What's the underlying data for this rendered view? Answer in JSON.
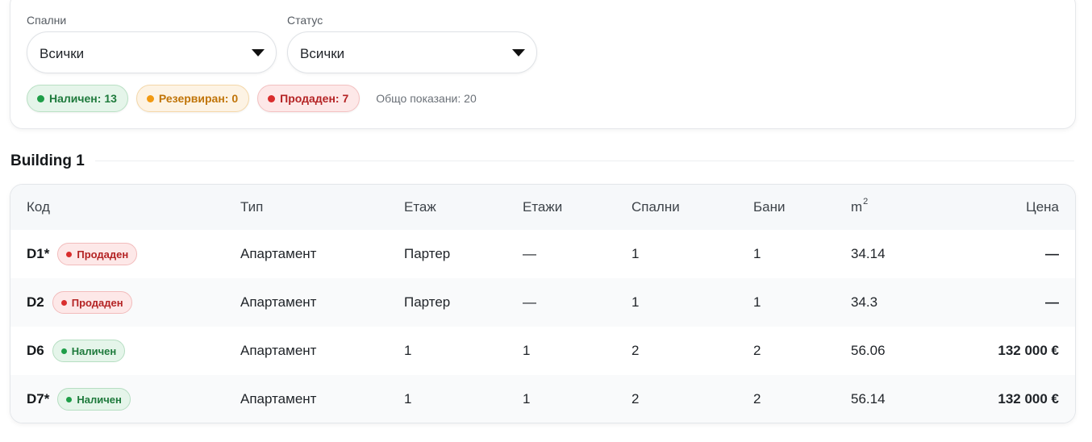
{
  "filters": {
    "bedrooms": {
      "label": "Спални",
      "value": "Всички"
    },
    "status": {
      "label": "Статус",
      "value": "Всички"
    }
  },
  "summary": {
    "available": "Наличен: 13",
    "reserved": "Резервиран: 0",
    "sold": "Продаден: 7",
    "total": "Общо показани: 20"
  },
  "colors": {
    "available": "#1e9e48",
    "reserved": "#f29a12",
    "sold": "#d92d2d"
  },
  "building": {
    "title": "Building 1"
  },
  "table": {
    "headers": {
      "code": "Код",
      "type": "Тип",
      "floor": "Етаж",
      "floors": "Етажи",
      "bedrooms": "Спални",
      "bathrooms": "Бани",
      "area": "m",
      "area_sup": "2",
      "price": "Цена"
    },
    "rows": [
      {
        "code": "D1*",
        "status": "Продаден",
        "type": "Апартамент",
        "floor": "Партер",
        "floors": "—",
        "bedrooms": "1",
        "bathrooms": "1",
        "area": "34.14",
        "price": "—"
      },
      {
        "code": "D2",
        "status": "Продаден",
        "type": "Апартамент",
        "floor": "Партер",
        "floors": "—",
        "bedrooms": "1",
        "bathrooms": "1",
        "area": "34.3",
        "price": "—"
      },
      {
        "code": "D6",
        "status": "Наличен",
        "type": "Апартамент",
        "floor": "1",
        "floors": "1",
        "bedrooms": "2",
        "bathrooms": "2",
        "area": "56.06",
        "price": "132 000 €"
      },
      {
        "code": "D7*",
        "status": "Наличен",
        "type": "Апартамент",
        "floor": "1",
        "floors": "1",
        "bedrooms": "2",
        "bathrooms": "2",
        "area": "56.14",
        "price": "132 000 €"
      }
    ]
  }
}
